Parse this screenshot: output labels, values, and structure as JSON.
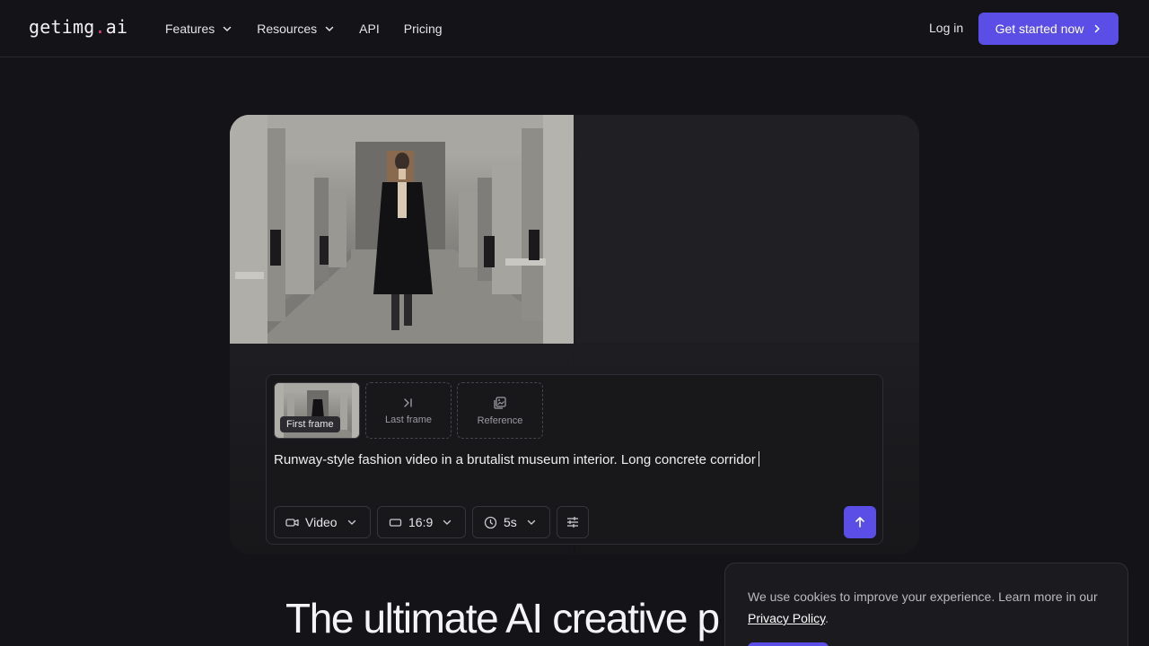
{
  "header": {
    "logo": {
      "text_a": "getimg",
      "text_dot": ".",
      "text_b": "ai"
    },
    "nav": [
      {
        "label": "Features",
        "has_dropdown": true
      },
      {
        "label": "Resources",
        "has_dropdown": true
      },
      {
        "label": "API",
        "has_dropdown": false
      },
      {
        "label": "Pricing",
        "has_dropdown": false
      }
    ],
    "login_label": "Log in",
    "cta_label": "Get started now"
  },
  "prompt_panel": {
    "first_frame_label": "First frame",
    "last_frame_label": "Last frame",
    "reference_label": "Reference",
    "prompt_text": "Runway-style fashion video in a brutalist museum interior. Long concrete corridor",
    "mode": "Video",
    "aspect_ratio": "16:9",
    "duration": "5s"
  },
  "headline": "The ultimate AI creative p",
  "cookie": {
    "text": "We use cookies to improve your experience. Learn more in our ",
    "link": "Privacy Policy",
    "suffix": "."
  },
  "colors": {
    "background": "#141418",
    "accent": "#5b4ee6",
    "logo_dot": "#e0457b"
  },
  "icons": [
    "chevron-down-icon",
    "chevron-right-icon",
    "last-frame-icon",
    "reference-image-icon",
    "video-camera-icon",
    "aspect-ratio-icon",
    "clock-icon",
    "sliders-icon",
    "arrow-up-icon"
  ]
}
